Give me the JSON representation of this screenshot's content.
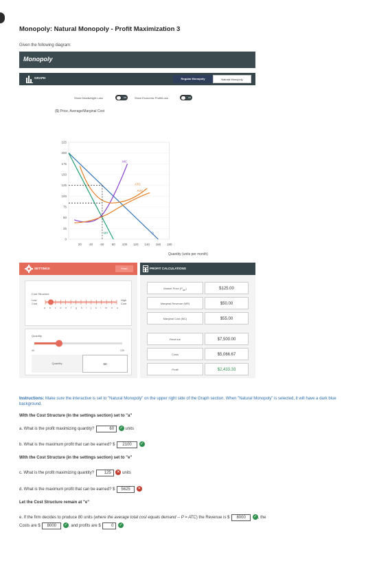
{
  "page_title": "Monopoly: Natural Monopoly - Profit Maximization 3",
  "given": "Given the following diagram:",
  "app": {
    "header": "Monopoly",
    "graph": {
      "label": "GRAPH",
      "toggle_regular": "Regular Monopoly",
      "toggle_natural": "Natural Monopoly",
      "show_deadweight": "Show Deadweight Loss",
      "show_econ": "Show Economic Profit/Loss",
      "switch_off": "Off",
      "y_title": "($) Price, Average/Marginal Cost",
      "x_title": "Quantity (units per month)",
      "y_ticks": [
        "225",
        "200",
        "175",
        "150",
        "125",
        "100",
        "75",
        "50",
        "25",
        "0"
      ],
      "x_ticks": [
        "20",
        "40",
        "60",
        "80",
        "100",
        "120",
        "140",
        "160",
        "180"
      ],
      "curve_labels": {
        "mc": "MC",
        "atc": "ATC",
        "avc": "AVC",
        "mr": "MR",
        "d": "D"
      }
    },
    "settings": {
      "label": "SETTINGS",
      "reset": "Reset",
      "cost_structure": "Cost Structure",
      "low_cost": "Low Cost",
      "high_cost": "High Cost",
      "letters": [
        "a",
        "b",
        "c",
        "d",
        "e",
        "f",
        "g",
        "h",
        "i",
        "j",
        "k",
        "l",
        "m",
        "n",
        "o"
      ],
      "quantity": "Quantity",
      "qty_min": "40",
      "qty_max": "120",
      "qty_input_label": "Quantity",
      "qty_value": "60"
    },
    "profit": {
      "label": "PROFIT CALCULATIONS",
      "rows": [
        {
          "label": "Market Price (P",
          "sub": "MP",
          "tail": ")",
          "value": "$125.00"
        },
        {
          "label": "Marginal Revenue (MR)",
          "value": "$50.00"
        },
        {
          "label": "Marginal Cost (MC)",
          "value": "$55.00"
        },
        {
          "label": "Revenue",
          "value": "$7,500.00"
        },
        {
          "label": "Costs",
          "value": "$5,066.67"
        },
        {
          "label": "Profit",
          "value": "$2,433.33"
        }
      ]
    }
  },
  "instructions": {
    "bold": "Instructions:",
    "text": " Make sure the interactive is set to \"Natural Monopoly\" on the upper right side of the Graph section. When \"Natural Monopoly\" is selected, it will have a dark blue background."
  },
  "section1": "With the Cost Structure (in the settings section) set to \"a\"",
  "qa": {
    "text": "a. What is the profit maximizing quantity?",
    "answer": "60",
    "unit": "units"
  },
  "qb": {
    "text": "b. What is the maximum profit that can be earned? $",
    "answer": "2100"
  },
  "section2": "With the Cost Structure (in the settings section) set to \"e\"",
  "qc": {
    "text": "c. What is the profit maximizing quantity?",
    "answer": "125",
    "unit": "units"
  },
  "qd": {
    "text": "d. What is the maximum profit that can be earned? $",
    "answer": "5625"
  },
  "section3": "Let the Cost Structure remain at \"e\"",
  "qe": {
    "pre": "e. If the firm decides to produce 80 units (",
    "italic": "where the average total cost equals demand -- P = ATC",
    "mid": ") the Revenue is $",
    "rev": "8000",
    "post": ", the",
    "costs_pre": "Costs are $",
    "costs": "8000",
    "profit_pre": ", and profits are $",
    "profit": "0"
  },
  "colors": {
    "header": "#3b4a4e",
    "settings": "#e46a5a",
    "demand": "#2f6fb0",
    "mr": "#1e9e73",
    "mc": "#8a3fc7",
    "atc": "#e67e22",
    "avc": "#e67e22",
    "correct": "#2f8f4e",
    "wrong": "#c0392b"
  }
}
